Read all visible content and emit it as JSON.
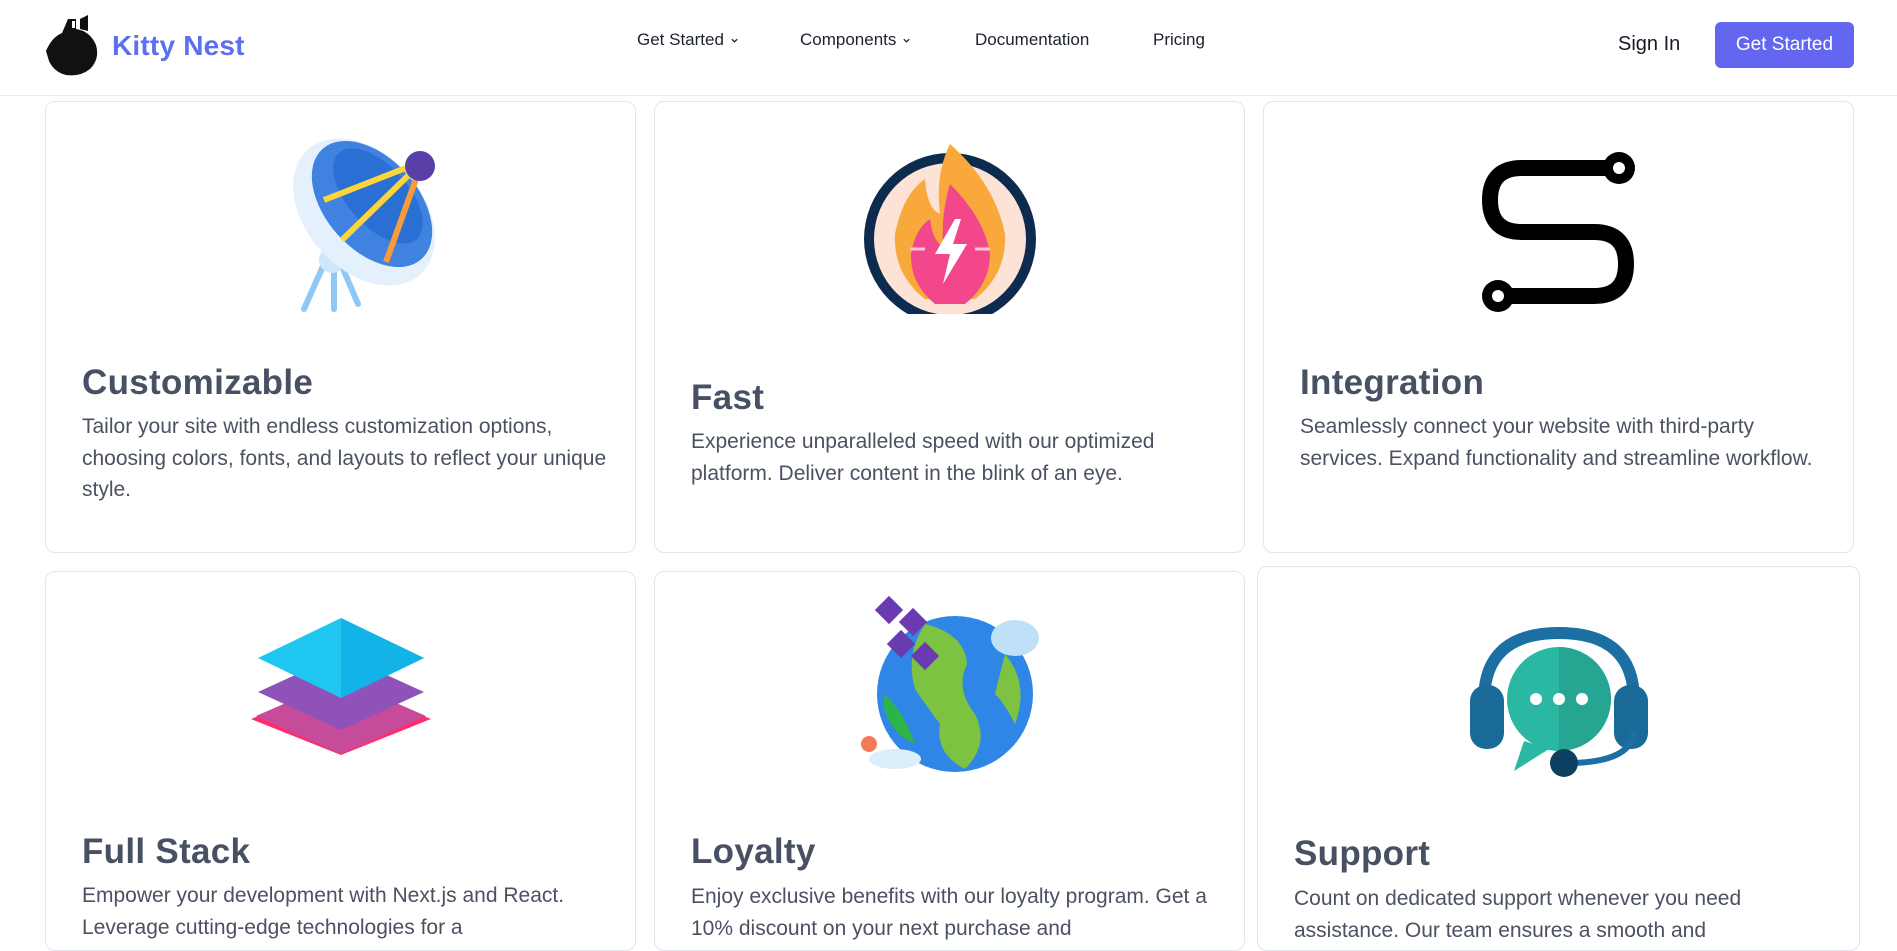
{
  "header": {
    "brand_name": "Kitty Nest",
    "nav": [
      {
        "label": "Get Started",
        "has_dropdown": true
      },
      {
        "label": "Components",
        "has_dropdown": true
      },
      {
        "label": "Documentation",
        "has_dropdown": false
      },
      {
        "label": "Pricing",
        "has_dropdown": false
      }
    ],
    "sign_in_label": "Sign In",
    "cta_label": "Get Started"
  },
  "features": [
    {
      "title": "Customizable",
      "description": "Tailor your site with endless customization options, choosing colors, fonts, and layouts to reflect your unique style.",
      "icon": "satellite-dish-icon"
    },
    {
      "title": "Fast",
      "description": "Experience unparalleled speed with our optimized platform. Deliver content in the blink of an eye.",
      "icon": "flame-bolt-icon"
    },
    {
      "title": "Integration",
      "description": "Seamlessly connect your website with third-party services. Expand functionality and streamline workflow.",
      "icon": "route-icon"
    },
    {
      "title": "Full Stack",
      "description": "Empower your development with Next.js and React. Leverage cutting-edge technologies for a",
      "icon": "layers-icon"
    },
    {
      "title": "Loyalty",
      "description": "Enjoy exclusive benefits with our loyalty program. Get a 10% discount on your next purchase and",
      "icon": "globe-icon"
    },
    {
      "title": "Support",
      "description": "Count on dedicated support whenever you need assistance. Our team ensures a smooth and",
      "icon": "headset-chat-icon"
    }
  ],
  "colors": {
    "brand": "#5b6ff0",
    "cta_bg": "#6366f1",
    "heading": "#475163",
    "body_text": "#4a5262"
  }
}
